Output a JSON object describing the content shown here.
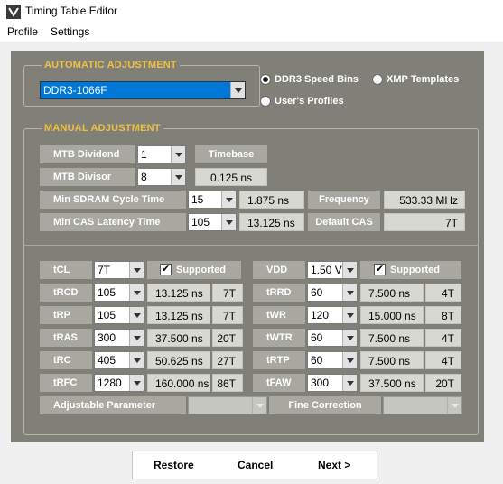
{
  "window": {
    "title": "Timing Table Editor"
  },
  "menu": {
    "items": [
      "Profile",
      "Settings"
    ]
  },
  "auto": {
    "title": "AUTOMATIC ADJUSTMENT",
    "profile_value": "DDR3-1066F",
    "radio_speedbins": "DDR3 Speed Bins",
    "radio_xmp": "XMP Templates",
    "radio_user": "User's Profiles"
  },
  "manual": {
    "title": "MANUAL ADJUSTMENT",
    "mtb_dividend_label": "MTB Dividend",
    "mtb_dividend_value": "1",
    "timebase_label": "Timebase",
    "mtb_divisor_label": "MTB Divisor",
    "mtb_divisor_value": "8",
    "timebase_value": "0.125 ns",
    "min_cycle_label": "Min SDRAM Cycle Time",
    "min_cycle_value": "15",
    "min_cycle_ns": "1.875 ns",
    "frequency_label": "Frequency",
    "frequency_value": "533.33 MHz",
    "min_cas_label": "Min CAS Latency Time",
    "min_cas_value": "105",
    "min_cas_ns": "13.125 ns",
    "default_cas_label": "Default CAS",
    "default_cas_value": "7T"
  },
  "timings": {
    "tcl_label": "tCL",
    "tcl_value": "7T",
    "tcl_supported": "Supported",
    "vdd_label": "VDD",
    "vdd_value": "1.50 V",
    "vdd_supported": "Supported",
    "left": [
      {
        "label": "tRCD",
        "value": "105",
        "ns": "13.125 ns",
        "t": "7T"
      },
      {
        "label": "tRP",
        "value": "105",
        "ns": "13.125 ns",
        "t": "7T"
      },
      {
        "label": "tRAS",
        "value": "300",
        "ns": "37.500 ns",
        "t": "20T"
      },
      {
        "label": "tRC",
        "value": "405",
        "ns": "50.625 ns",
        "t": "27T"
      },
      {
        "label": "tRFC",
        "value": "1280",
        "ns": "160.000 ns",
        "t": "86T"
      }
    ],
    "right": [
      {
        "label": "tRRD",
        "value": "60",
        "ns": "7.500 ns",
        "t": "4T"
      },
      {
        "label": "tWR",
        "value": "120",
        "ns": "15.000 ns",
        "t": "8T"
      },
      {
        "label": "tWTR",
        "value": "60",
        "ns": "7.500 ns",
        "t": "4T"
      },
      {
        "label": "tRTP",
        "value": "60",
        "ns": "7.500 ns",
        "t": "4T"
      },
      {
        "label": "tFAW",
        "value": "300",
        "ns": "37.500 ns",
        "t": "20T"
      }
    ],
    "adjustable_label": "Adjustable Parameter",
    "fine_correction_label": "Fine Correction"
  },
  "buttons": {
    "restore": "Restore",
    "cancel": "Cancel",
    "next": "Next >"
  },
  "colors": {
    "panel": "#808078",
    "group_title": "#f0c040",
    "label_bg": "#a8a8a0",
    "value_bg": "#d8d8d2",
    "selection": "#0078d7"
  }
}
